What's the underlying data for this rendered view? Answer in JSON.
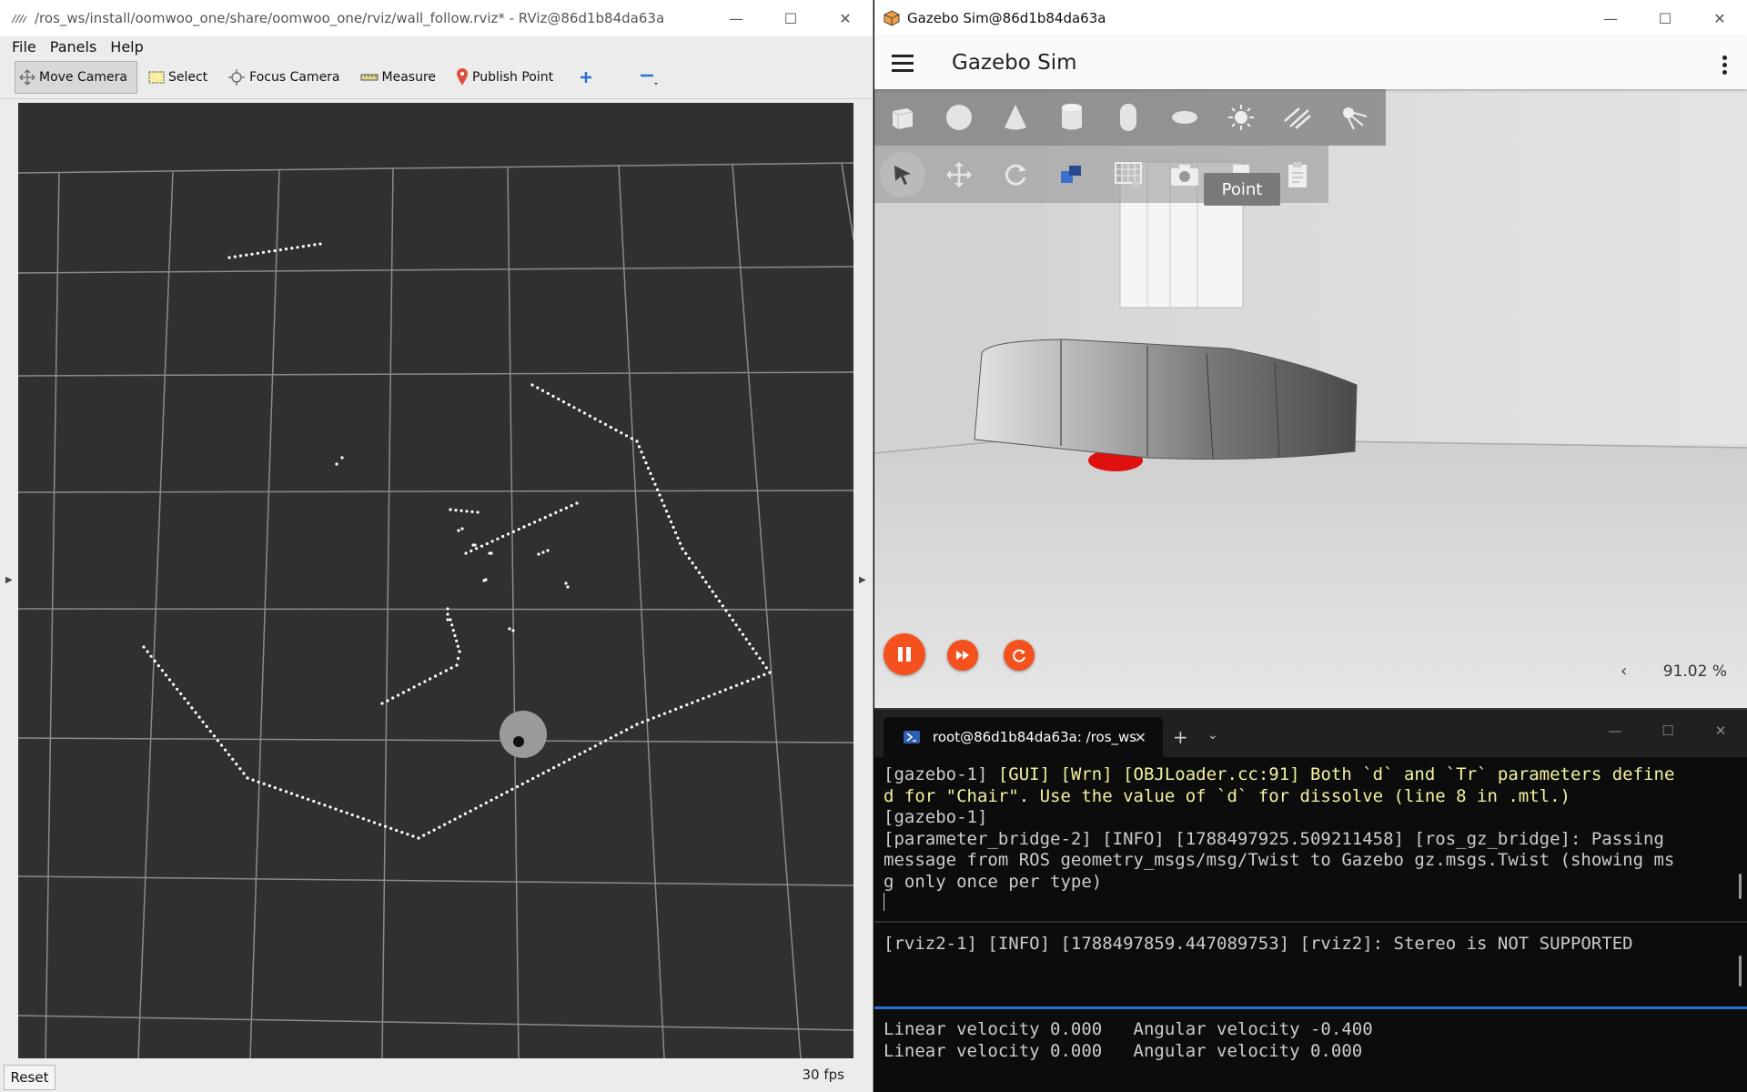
{
  "rviz": {
    "title": "/ros_ws/install/oomwoo_one/share/oomwoo_one/rviz/wall_follow.rviz* - RViz@86d1b84da63a",
    "window_controls": [
      "—",
      "☐",
      "✕"
    ],
    "menu": [
      "File",
      "Panels",
      "Help"
    ],
    "tools": [
      {
        "label": "Move Camera",
        "icon": "move-camera-icon"
      },
      {
        "label": "Select",
        "icon": "select-icon"
      },
      {
        "label": "Focus Camera",
        "icon": "focus-camera-icon"
      },
      {
        "label": "Measure",
        "icon": "measure-icon"
      },
      {
        "label": "Publish Point",
        "icon": "publish-point-icon"
      }
    ],
    "add_tool_icon": "plus-icon",
    "remove_tool_icon": "minus-icon",
    "reset_label": "Reset",
    "fps": "30 fps"
  },
  "gazebo": {
    "title": "Gazebo Sim@86d1b84da63a",
    "window_controls": [
      "—",
      "☐",
      "✕"
    ],
    "app_title": "Gazebo Sim",
    "shapes": [
      "box-icon",
      "sphere-icon",
      "cone-icon",
      "cylinder-icon",
      "capsule-icon",
      "ellipsoid-icon",
      "point-light-icon",
      "directional-light-icon",
      "spot-light-icon"
    ],
    "tools": [
      "select-icon",
      "translate-icon",
      "rotate-icon",
      "transform-icon",
      "grid-icon",
      "screenshot-icon",
      "copy-icon",
      "paste-icon"
    ],
    "tooltip": "Point",
    "real_time_factor": "91.02 %",
    "accent_color": "#f4511e"
  },
  "terminal": {
    "tab_title": "root@86d1b84da63a: /ros_ws",
    "pane1": {
      "lines": [
        {
          "prefix": "[gazebo-1] ",
          "text": "[GUI] [Wrn] [OBJLoader.cc:91] Both `d` and `Tr` parameters define"
        },
        {
          "prefix": "",
          "text": "d for \"Chair\". Use the value of `d` for dissolve (line 8 in .mtl.)"
        },
        {
          "prefix": "[gazebo-1]",
          "text": ""
        },
        {
          "prefix": "[parameter_bridge-2] [INFO] [1788497925.509211458] [ros_gz_bridge]: Passing",
          "text": ""
        },
        {
          "prefix": "message from ROS geometry_msgs/msg/Twist to Gazebo gz.msgs.Twist (showing ms",
          "text": ""
        },
        {
          "prefix": "g only once per type)",
          "text": ""
        }
      ]
    },
    "pane2": {
      "lines": [
        "[rviz2-1] [INFO] [1788497859.447089753] [rviz2]: Stereo is NOT SUPPORTED"
      ]
    },
    "pane3": {
      "lines": [
        "Linear velocity 0.000   Angular velocity -0.400",
        "Linear velocity 0.000   Angular velocity 0.000"
      ]
    }
  }
}
